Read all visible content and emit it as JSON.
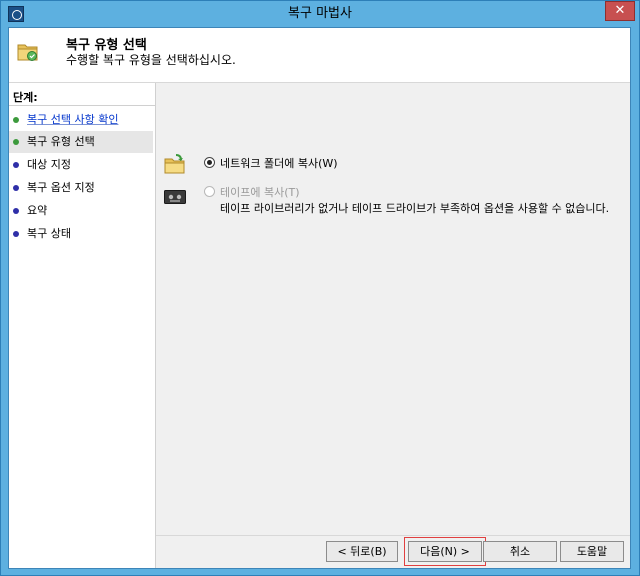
{
  "window": {
    "title": "복구 마법사",
    "close_label": "✕"
  },
  "header": {
    "title": "복구 유형 선택",
    "subtitle": "수행할 복구 유형을 선택하십시오."
  },
  "steps": {
    "title": "단계:",
    "items": [
      {
        "label": "복구 선택 사항 확인",
        "state": "done"
      },
      {
        "label": "복구 유형 선택",
        "state": "current"
      },
      {
        "label": "대상 지정",
        "state": "todo"
      },
      {
        "label": "복구 옵션 지정",
        "state": "todo"
      },
      {
        "label": "요약",
        "state": "todo"
      },
      {
        "label": "복구 상태",
        "state": "todo"
      }
    ]
  },
  "options": {
    "network": {
      "label": "네트워크 폴더에 복사(W)",
      "selected": true,
      "enabled": true
    },
    "tape": {
      "label": "테이프에 복사(T)",
      "selected": false,
      "enabled": false,
      "note": "테이프 라이브러리가 없거나 테이프 드라이브가 부족하여 옵션을 사용할 수 없습니다."
    }
  },
  "buttons": {
    "back": "< 뒤로(B)",
    "next": "다음(N) >",
    "cancel": "취소",
    "help": "도움말"
  },
  "colors": {
    "titlebar": "#5db0e0",
    "accent_red": "#e04040",
    "step_done": "#3c9a3c",
    "step_todo": "#2f2fa8"
  }
}
